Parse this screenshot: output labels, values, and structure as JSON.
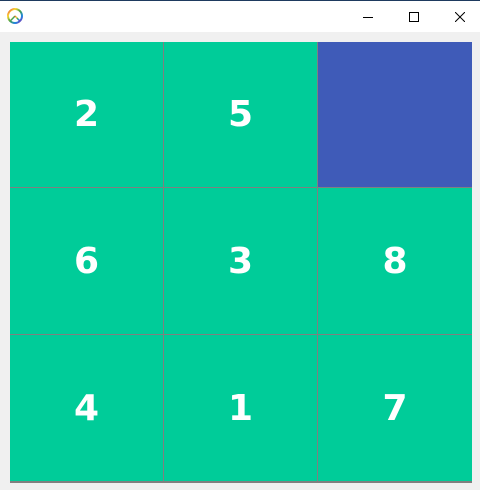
{
  "window": {
    "icon": "peace-sign-icon",
    "controls": [
      "minimize",
      "maximize",
      "close"
    ]
  },
  "puzzle": {
    "tile_color": "#00cc99",
    "empty_color": "#3f5bb8",
    "board_border_color": "#808080",
    "tiles": [
      "2",
      "5",
      "",
      "6",
      "3",
      "8",
      "4",
      "1",
      "7"
    ]
  }
}
